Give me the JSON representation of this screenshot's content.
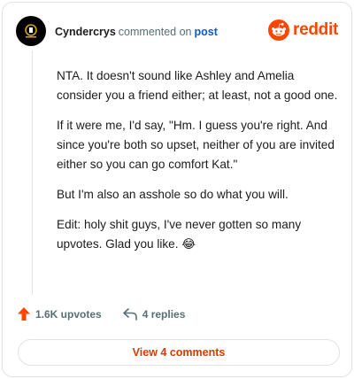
{
  "comment": {
    "username": "Cyndercrys",
    "action_text": "commented on",
    "post_link": "post",
    "paragraphs": [
      "NTA. It doesn't sound like Ashley and Amelia consider you a friend either; at least, not a good one.",
      "If it were me, I'd say, \"Hm. I guess you're right. And since you're both so upset, neither of you are invited either so you can go comfort Kat.\"",
      "But I'm also an asshole so do what you will.",
      "Edit: holy shit guys, I've never gotten so many upvotes. Glad you like. 😂"
    ]
  },
  "brand": {
    "name": "reddit",
    "color": "#ff4500"
  },
  "actions": {
    "upvotes": "1.6K upvotes",
    "replies": "4 replies"
  },
  "view_button": "View 4 comments"
}
